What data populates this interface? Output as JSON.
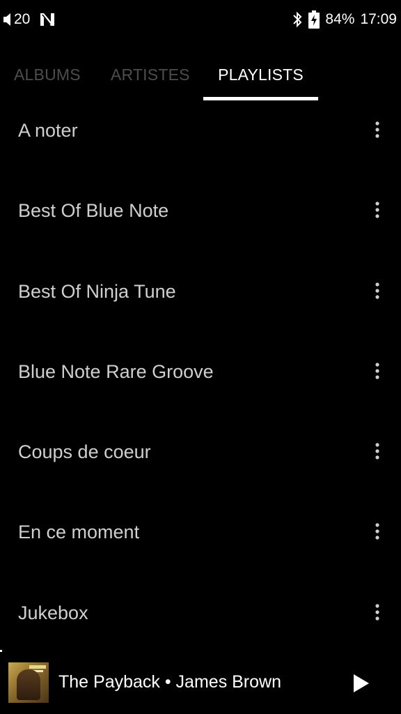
{
  "status_bar": {
    "volume_level": "20",
    "battery_percent": "84%",
    "time": "17:09",
    "icons": [
      "volume-icon",
      "notification-n-icon",
      "bluetooth-icon",
      "battery-charging-icon"
    ]
  },
  "tabs": [
    {
      "label": "ALBUMS",
      "selected": false
    },
    {
      "label": "ARTISTES",
      "selected": false
    },
    {
      "label": "PLAYLISTS",
      "selected": true
    }
  ],
  "playlists": [
    {
      "label": "A noter"
    },
    {
      "label": "Best Of Blue Note"
    },
    {
      "label": "Best Of Ninja Tune"
    },
    {
      "label": "Blue Note Rare Groove"
    },
    {
      "label": "Coups de coeur"
    },
    {
      "label": "En ce moment"
    },
    {
      "label": "Jukebox"
    }
  ],
  "now_playing": {
    "track_title": "The Payback • James Brown"
  },
  "colors": {
    "background": "#000000",
    "tab_selected": "#ffffff",
    "tab_unselected": "#4d4d4d",
    "row_text": "#cfcfcf"
  }
}
